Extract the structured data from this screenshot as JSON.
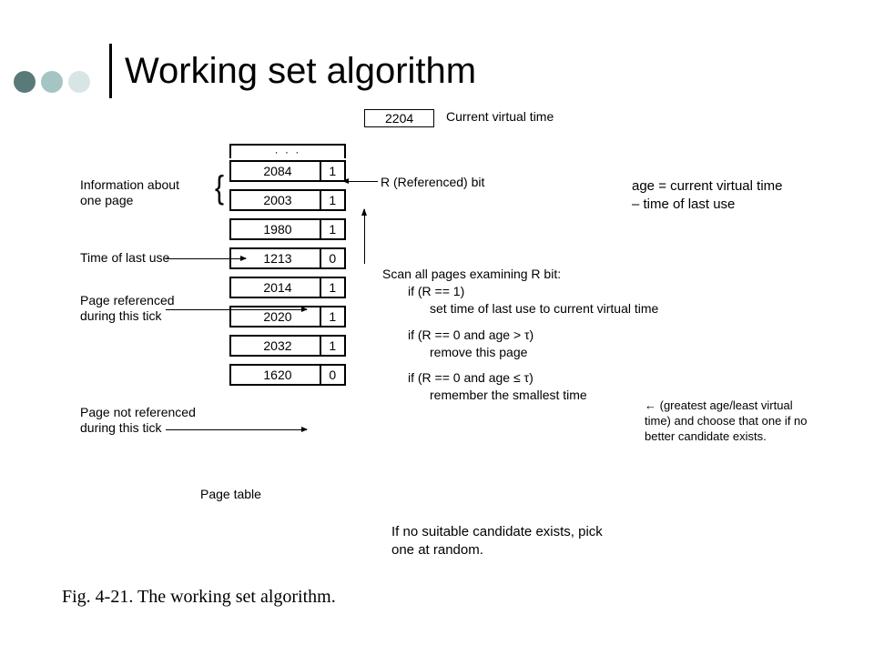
{
  "title": "Working set algorithm",
  "current_virtual_time": {
    "value": "2204",
    "label": "Current virtual time"
  },
  "left_labels": {
    "info": "Information about\none page",
    "tolu": "Time of last use",
    "ref_tick": "Page referenced\nduring this tick",
    "notref_tick": "Page not referenced\nduring this tick",
    "page_table": "Page table"
  },
  "r_bit_label": "R (Referenced) bit",
  "rows": [
    {
      "time": "2084",
      "r": "1"
    },
    {
      "time": "2003",
      "r": "1"
    },
    {
      "time": "1980",
      "r": "1"
    },
    {
      "time": "1213",
      "r": "0"
    },
    {
      "time": "2014",
      "r": "1"
    },
    {
      "time": "2020",
      "r": "1"
    },
    {
      "time": "2032",
      "r": "1"
    },
    {
      "time": "1620",
      "r": "0"
    }
  ],
  "algorithm": {
    "scan": "Scan all pages examining R bit:",
    "c1": "if (R == 1)",
    "a1": "set time of last use to current virtual time",
    "c2": "if (R == 0 and age > τ)",
    "a2": "remove this page",
    "c3": "if (R == 0 and age ≤ τ)",
    "a3": "remember the smallest time"
  },
  "age_def": "age = current virtual time – time of last use",
  "extra_note": "← (greatest age/least virtual time) and choose that one if no better candidate exists.",
  "no_suitable": "If no suitable candidate exists, pick one at random.",
  "caption": "Fig. 4-21.  The working set algorithm."
}
